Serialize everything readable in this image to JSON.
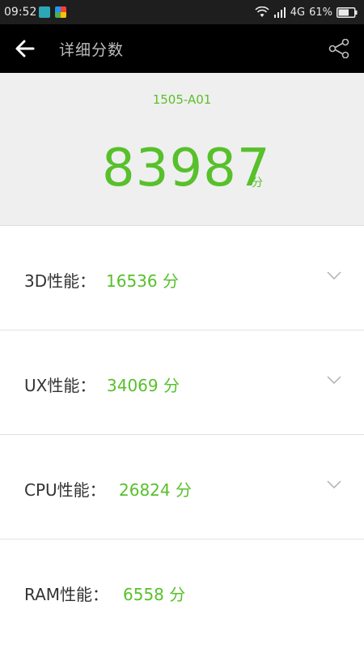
{
  "status_bar": {
    "time": "09:52",
    "network": "4G",
    "battery": "61%"
  },
  "app_bar": {
    "title": "详细分数",
    "back_icon": "arrow-left-icon",
    "share_icon": "share-icon"
  },
  "summary": {
    "device": "1505-A01",
    "total_score": "83987",
    "unit": "分"
  },
  "rows": [
    {
      "label": "3D性能：",
      "score": "16536 分",
      "expandable": true
    },
    {
      "label": "UX性能：",
      "score": "34069 分",
      "expandable": true
    },
    {
      "label": "CPU性能：",
      "score": "26824 分",
      "expandable": true
    },
    {
      "label": "RAM性能：",
      "score": "6558 分",
      "expandable": false
    }
  ],
  "colors": {
    "accent": "#57c02b",
    "appbar": "#000000",
    "panel": "#efefef"
  }
}
